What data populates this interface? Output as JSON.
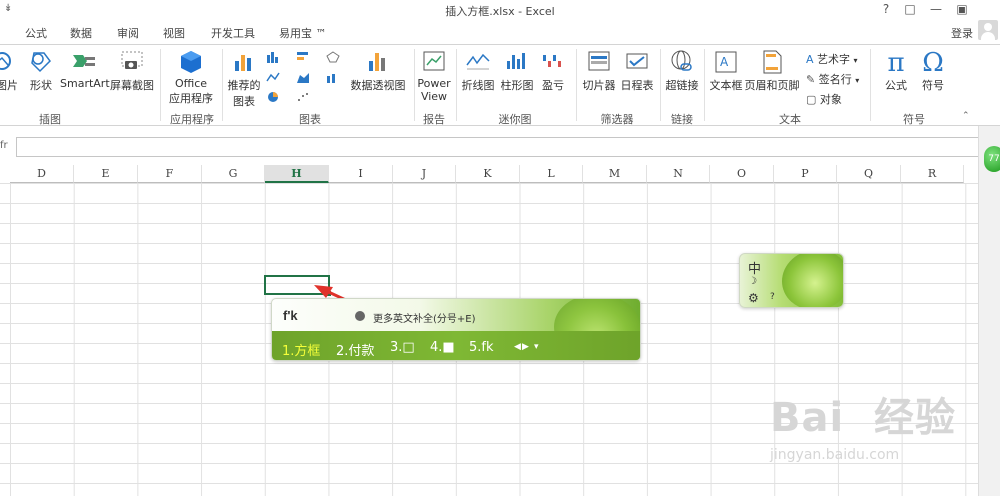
{
  "window": {
    "title": "插入方框.xlsx - Excel",
    "qat_symbol": "↡",
    "controls": [
      "?",
      "□",
      "—",
      "▣"
    ]
  },
  "tabs": [
    "公式",
    "数据",
    "审阅",
    "视图",
    "开发工具",
    "易用宝 ™"
  ],
  "account": {
    "login_label": "登录"
  },
  "ribbon": {
    "insert_group": {
      "picture": "图片",
      "shapes": "形状",
      "smartart": "SmartArt",
      "screenshot": "屏幕截图",
      "group_label": "插图"
    },
    "apps_group": {
      "office_line1": "Office",
      "office_line2": "应用程序",
      "group_label": "应用程序"
    },
    "charts_group": {
      "recommended_line1": "推荐的",
      "recommended_line2": "图表",
      "pivotchart": "数据透视图",
      "group_label": "图表"
    },
    "reports_group": {
      "powerview_line1": "Power",
      "powerview_line2": "View",
      "group_label": "报告"
    },
    "sparklines_group": {
      "line": "折线图",
      "column": "柱形图",
      "winloss": "盈亏",
      "group_label": "迷你图"
    },
    "filters_group": {
      "slicer": "切片器",
      "timeline": "日程表",
      "group_label": "筛选器"
    },
    "links_group": {
      "hyperlink": "超链接",
      "group_label": "链接"
    },
    "text_group": {
      "textbox": "文本框",
      "header_footer": "页眉和页脚",
      "wordart": "艺术字",
      "signature": "签名行",
      "object": "对象",
      "group_label": "文本"
    },
    "symbols_group": {
      "equation": "公式",
      "equation_symbol": "π",
      "symbol": "符号",
      "symbol_glyph": "Ω",
      "group_label": "符号"
    }
  },
  "formula_bar": {
    "fx_label": "fr",
    "value": ""
  },
  "grid": {
    "columns": [
      "D",
      "E",
      "F",
      "G",
      "H",
      "I",
      "J",
      "K",
      "L",
      "M",
      "N",
      "O",
      "P",
      "Q",
      "R"
    ],
    "selected_column": "H"
  },
  "ime_candidates": {
    "pinyin": "f'k",
    "hint": "更多英文补全(分号+E)",
    "items": [
      "1.方框",
      "2.付款",
      "3.□",
      "4.■",
      "5.fk"
    ],
    "selected_index": 0,
    "nav": [
      "◀",
      "▶",
      "▾"
    ]
  },
  "ime_status": {
    "mode": "中",
    "moon": "☽",
    "gear": "⚙",
    "help": "?"
  },
  "float_badge": "77",
  "watermark": {
    "brand": "Bai  经验",
    "url": "jingyan.baidu.com"
  },
  "colors": {
    "excel_green": "#217346",
    "ime_green": "#7fb834",
    "selected_candidate": "#f5ff3a",
    "arrow_red": "#e0322b"
  }
}
